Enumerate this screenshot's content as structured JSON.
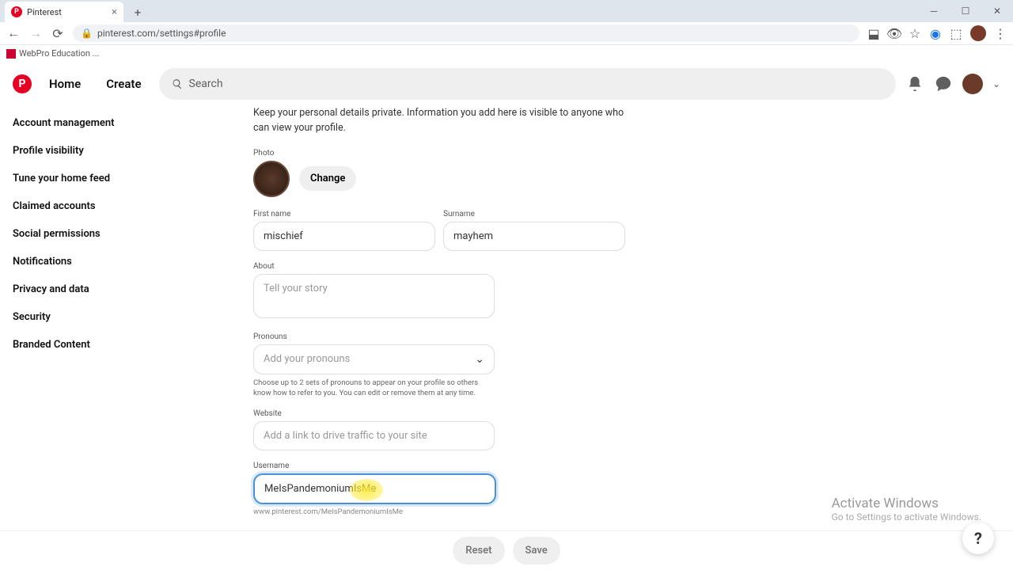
{
  "browser": {
    "tab_title": "Pinterest",
    "url": "pinterest.com/settings#profile",
    "bookmark": "WebPro Education ..."
  },
  "header": {
    "home": "Home",
    "create": "Create",
    "search_placeholder": "Search"
  },
  "sidebar": {
    "items": [
      "Account management",
      "Profile visibility",
      "Tune your home feed",
      "Claimed accounts",
      "Social permissions",
      "Notifications",
      "Privacy and data",
      "Security",
      "Branded Content"
    ]
  },
  "form": {
    "intro": "Keep your personal details private. Information you add here is visible to anyone who can view your profile.",
    "photo_label": "Photo",
    "change": "Change",
    "first_name_label": "First name",
    "first_name_value": "mischief",
    "surname_label": "Surname",
    "surname_value": "mayhem",
    "about_label": "About",
    "about_placeholder": "Tell your story",
    "pronouns_label": "Pronouns",
    "pronouns_placeholder": "Add your pronouns",
    "pronouns_helper": "Choose up to 2 sets of pronouns to appear on your profile so others know how to refer to you. You can edit or remove them at any time.",
    "website_label": "Website",
    "website_placeholder": "Add a link to drive traffic to your site",
    "username_label": "Username",
    "username_value": "MeIsPandemoniumIsMe",
    "username_url": "www.pinterest.com/MeIsPandemoniumIsMe"
  },
  "footer": {
    "reset": "Reset",
    "save": "Save"
  },
  "activate": {
    "line1": "Activate Windows",
    "line2": "Go to Settings to activate Windows."
  }
}
